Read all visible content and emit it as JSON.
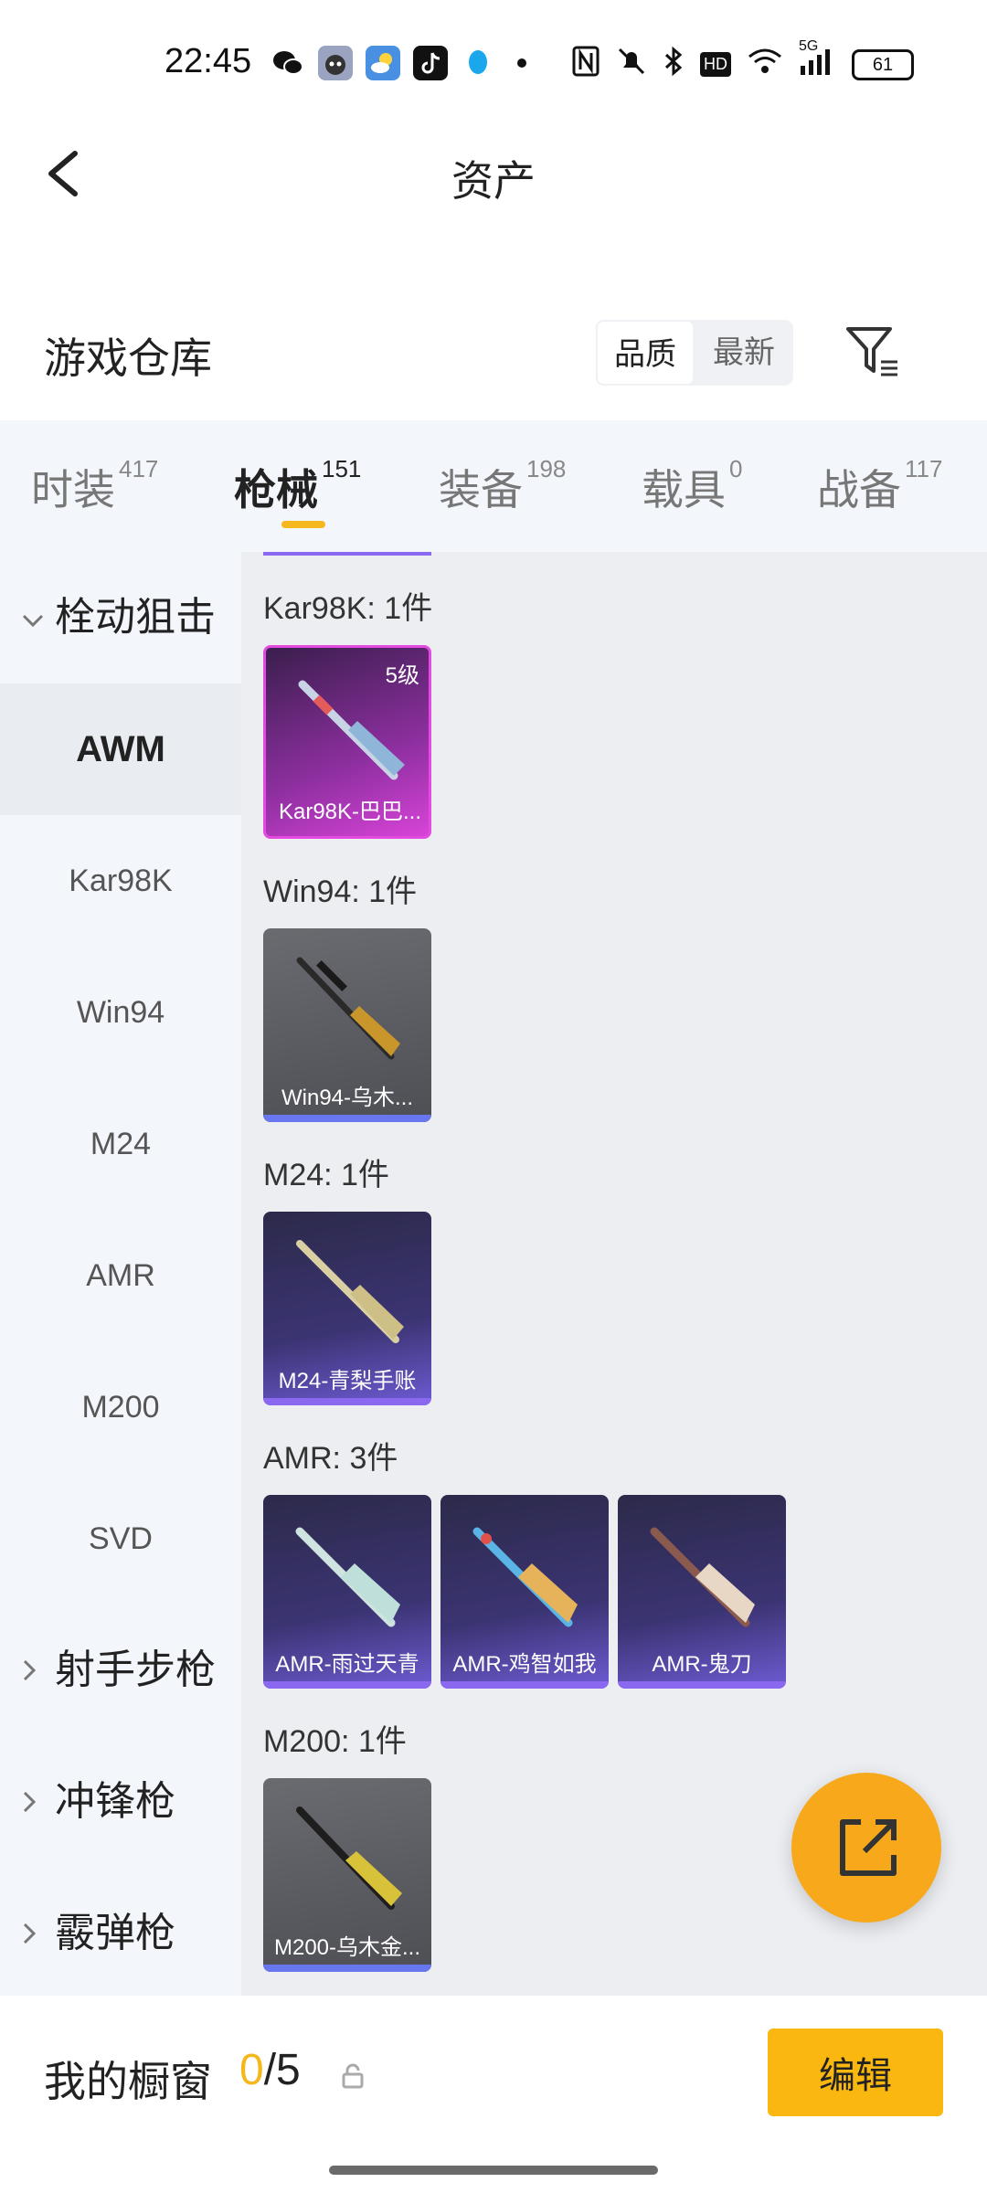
{
  "status_bar": {
    "time": "22:45",
    "network": "5G",
    "battery": "61",
    "hd": "HD"
  },
  "header": {
    "title": "资产"
  },
  "warehouse": {
    "title": "游戏仓库",
    "sort_quality": "品质",
    "sort_newest": "最新"
  },
  "tabs": [
    {
      "label": "时装",
      "count": "417"
    },
    {
      "label": "枪械",
      "count": "151"
    },
    {
      "label": "装备",
      "count": "198"
    },
    {
      "label": "载具",
      "count": "0"
    },
    {
      "label": "战备",
      "count": "117"
    }
  ],
  "sidebar": {
    "group_bolt": "栓动狙击",
    "items": [
      "AWM",
      "Kar98K",
      "Win94",
      "M24",
      "AMR",
      "M200",
      "SVD"
    ],
    "group_dmr": "射手步枪",
    "group_smg": "冲锋枪",
    "group_shotgun": "霰弹枪"
  },
  "sections": {
    "kar98k": {
      "label": "Kar98K: 1件",
      "card": "Kar98K-巴巴...",
      "level": "5级"
    },
    "win94": {
      "label": "Win94: 1件",
      "card": "Win94-乌木..."
    },
    "m24": {
      "label": "M24: 1件",
      "card": "M24-青梨手账"
    },
    "amr": {
      "label": "AMR: 3件",
      "cards": [
        "AMR-雨过天青",
        "AMR-鸡智如我",
        "AMR-鬼刀"
      ]
    },
    "m200": {
      "label": "M200: 1件",
      "card": "M200-乌木金..."
    }
  },
  "bottom": {
    "title": "我的橱窗",
    "count_current": "0",
    "count_total": "/5",
    "edit_label": "编辑"
  },
  "colors": {
    "accent": "#f5b81c",
    "button": "#f9b70f",
    "fab": "#f7a81b"
  }
}
